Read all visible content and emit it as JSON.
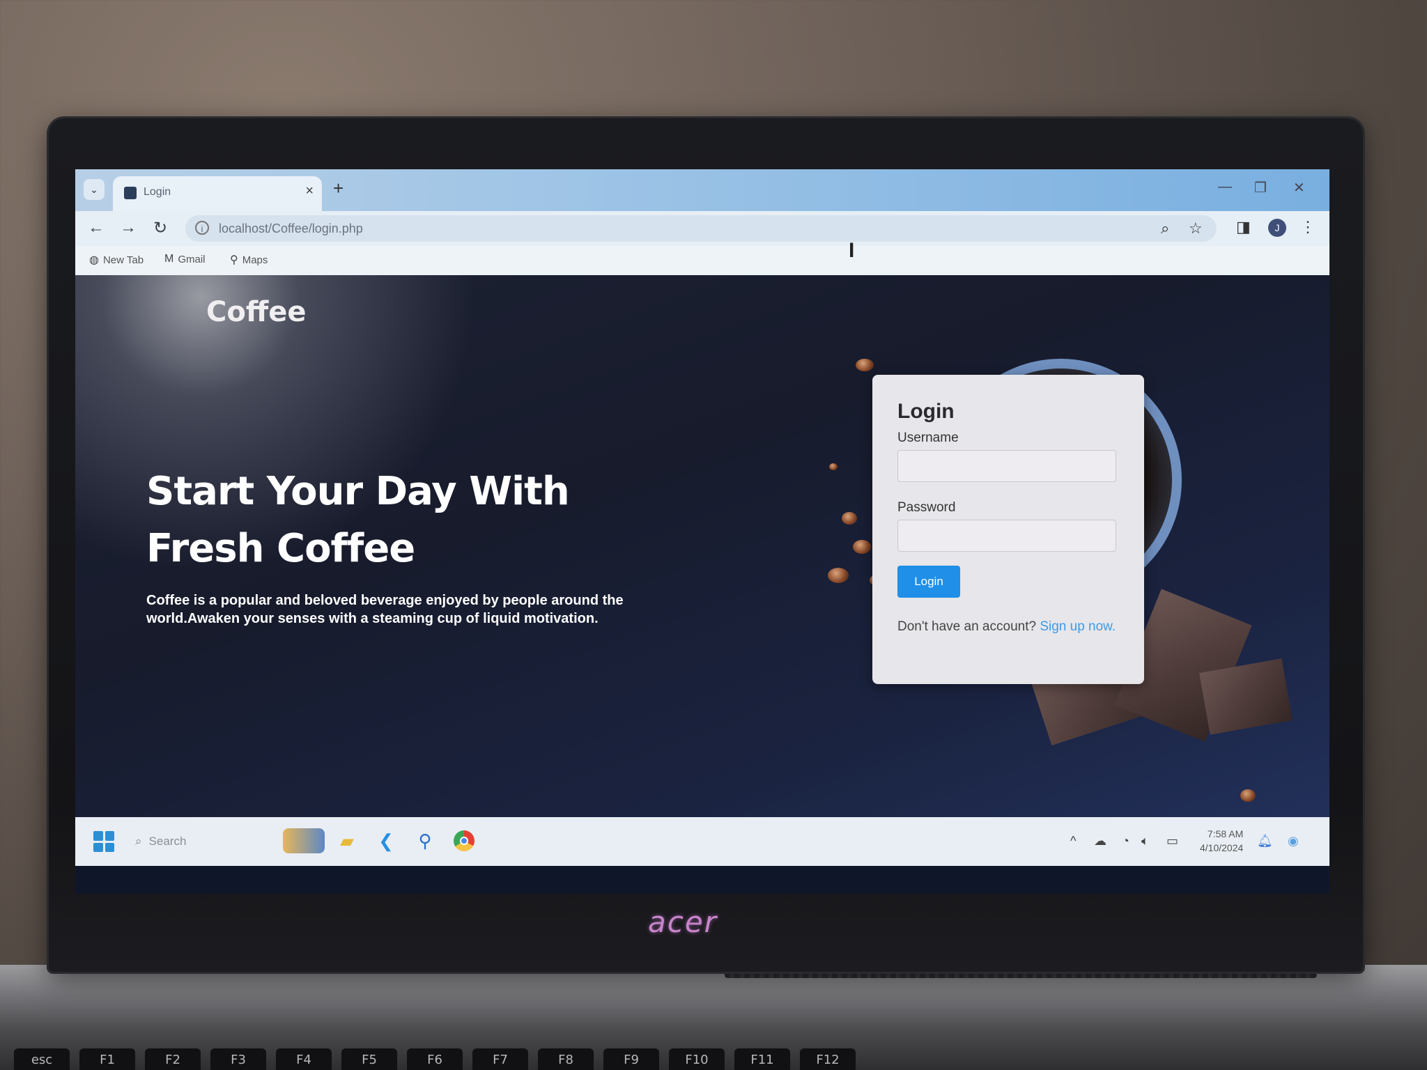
{
  "browser": {
    "tab_title": "Login",
    "tab_close": "×",
    "new_tab": "+",
    "url": "localhost/Coffee/login.php",
    "bookmarks": [
      {
        "label": "New Tab",
        "icon": "globe-icon"
      },
      {
        "label": "Gmail",
        "icon": "gmail-icon"
      },
      {
        "label": "Maps",
        "icon": "maps-pin-icon"
      }
    ],
    "profile_initial": "J"
  },
  "site": {
    "logo": "Coffee",
    "hero_title": "Start Your Day With Fresh Coffee",
    "hero_text": "Coffee is a popular and beloved beverage enjoyed by people around the world.Awaken your senses with a steaming cup of liquid motivation."
  },
  "login": {
    "title": "Login",
    "username_label": "Username",
    "username_value": "",
    "password_label": "Password",
    "password_value": "",
    "button_label": "Login",
    "signup_prompt": "Don't have an account? ",
    "signup_link": "Sign up now.",
    "accent_color": "#1f8fe8"
  },
  "taskbar": {
    "search_placeholder": "Search",
    "time": "7:58 AM",
    "date": "4/10/2024",
    "apps": [
      "widgets-icon",
      "file-explorer-icon",
      "vscode-icon",
      "app-icon",
      "chrome-icon"
    ]
  },
  "laptop": {
    "brand": "acer",
    "keys": [
      "esc",
      "F1",
      "F2",
      "F3",
      "F4",
      "F5",
      "F6",
      "F7",
      "F8",
      "F9",
      "F10",
      "F11",
      "F12"
    ]
  }
}
